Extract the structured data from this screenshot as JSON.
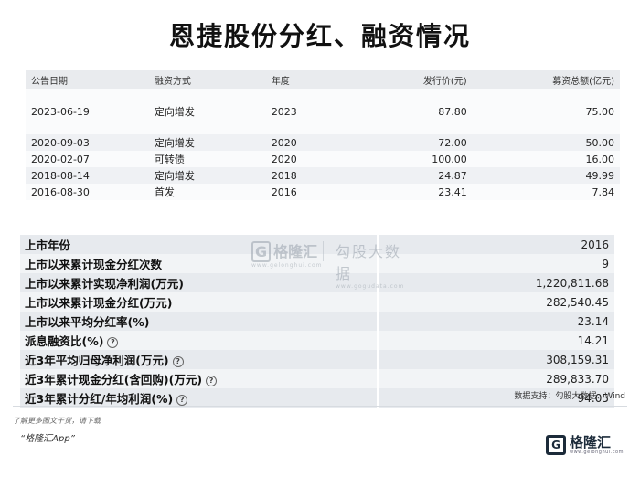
{
  "title": "恩捷股份分红、融资情况",
  "financing": {
    "headers": [
      "公告日期",
      "融资方式",
      "年度",
      "发行价(元)",
      "募资总额(亿元)"
    ],
    "rows": [
      [
        "2023-06-19",
        "定向增发",
        "2023",
        "87.80",
        "75.00"
      ],
      [
        "2020-09-03",
        "定向增发",
        "2020",
        "72.00",
        "50.00"
      ],
      [
        "2020-02-07",
        "可转债",
        "2020",
        "100.00",
        "16.00"
      ],
      [
        "2018-08-14",
        "定向增发",
        "2018",
        "24.87",
        "49.99"
      ],
      [
        "2016-08-30",
        "首发",
        "2016",
        "23.41",
        "7.84"
      ]
    ]
  },
  "stats": [
    {
      "label": "上市年份",
      "value": "2016",
      "help": false
    },
    {
      "label": "上市以来累计现金分红次数",
      "value": "9",
      "help": false
    },
    {
      "label": "上市以来累计实现净利润(万元)",
      "value": "1,220,811.68",
      "help": false
    },
    {
      "label": "上市以来累计现金分红(万元)",
      "value": "282,540.45",
      "help": false
    },
    {
      "label": "上市以来平均分红率(%)",
      "value": "23.14",
      "help": false
    },
    {
      "label": "派息融资比(%)",
      "value": "14.21",
      "help": true
    },
    {
      "label": "近3年平均归母净利润(万元)",
      "value": "308,159.31",
      "help": true
    },
    {
      "label": "近3年累计现金分红(含回购)(万元)",
      "value": "289,833.70",
      "help": true
    },
    {
      "label": "近3年累计分红/年均利润(%)",
      "value": "94.05",
      "help": true
    }
  ],
  "help_glyph": "?",
  "watermark": {
    "logo_letter": "G",
    "logo_text": "格隆汇",
    "logo_url": "www.gelonghui.com",
    "right_text": "勾股大数据",
    "right_url": "www.gogudata.com"
  },
  "source": "数据支持：勾股大数据、Wind",
  "promo_line1": "了解更多图文干货，请下载",
  "promo_line2": "“格隆汇App”",
  "brand": {
    "letter": "G",
    "name": "格隆汇",
    "url": "www.gelonghui.com"
  }
}
